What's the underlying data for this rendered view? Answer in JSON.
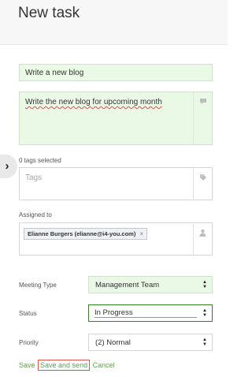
{
  "header": {
    "title": "New task"
  },
  "task": {
    "title_value": "Write a new blog",
    "description_value": "Write the new blog for upcoming month"
  },
  "tags": {
    "count_text": "0 tags selected",
    "placeholder": "Tags"
  },
  "assigned": {
    "label": "Assigned to",
    "chip_text": "Elianne Burgers (elianne@i4-you.com)",
    "chip_remove": "×"
  },
  "form": {
    "meeting_type": {
      "label": "Meeting Type",
      "value": "Management Team"
    },
    "status": {
      "label": "Status",
      "value": "In Progress"
    },
    "priority": {
      "label": "Priority",
      "value": "(2) Normal"
    }
  },
  "actions": {
    "save": "Save",
    "save_and_send": "Save and send",
    "cancel": "Cancel"
  },
  "icons": {
    "expand": "›",
    "comment": "💬",
    "tag": "🏷",
    "user": "👤",
    "caret_up": "▲",
    "caret_down": "▼"
  },
  "colors": {
    "accent_green": "#5aa83e",
    "field_green_bg": "#eaf8e6",
    "active_border": "#3d7a2a",
    "highlight_red": "#d9534f"
  }
}
